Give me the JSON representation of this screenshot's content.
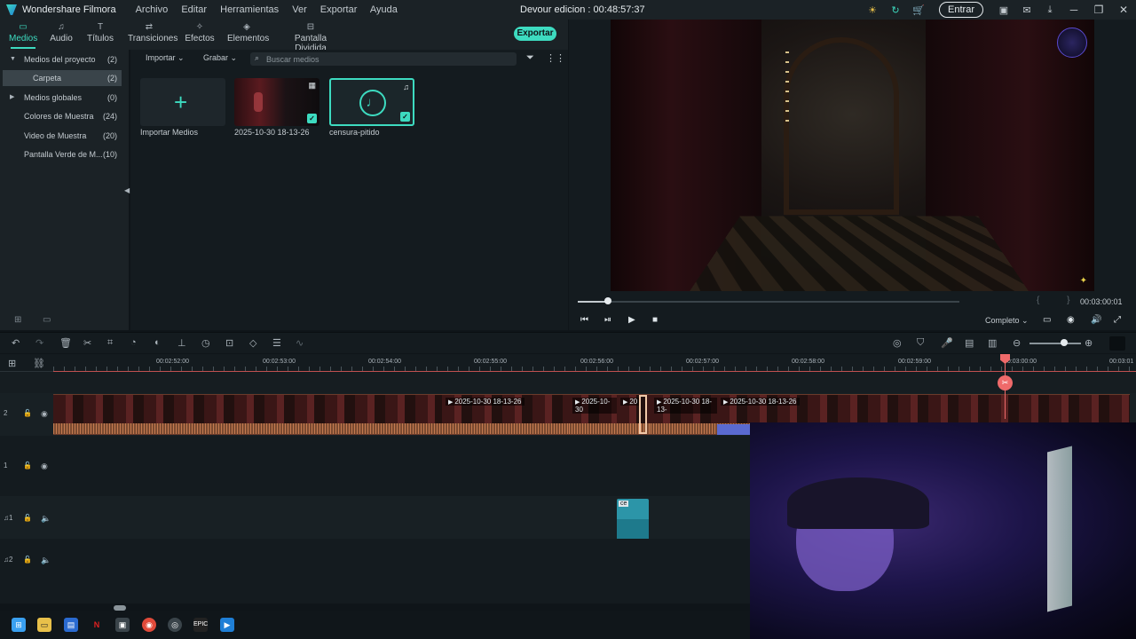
{
  "app": {
    "name": "Wondershare Filmora",
    "project_title": "Devour edicion : 00:48:57:37",
    "menu": [
      "Archivo",
      "Editar",
      "Herramientas",
      "Ver",
      "Exportar",
      "Ayuda"
    ],
    "login_label": "Entrar"
  },
  "tabs": [
    {
      "label": "Medios",
      "icon": "folder-icon",
      "active": true
    },
    {
      "label": "Audio",
      "icon": "music-icon"
    },
    {
      "label": "Títulos",
      "icon": "text-icon"
    },
    {
      "label": "Transiciones",
      "icon": "transition-icon"
    },
    {
      "label": "Efectos",
      "icon": "effects-icon"
    },
    {
      "label": "Elementos",
      "icon": "elements-icon"
    },
    {
      "label": "Pantalla Dividida",
      "icon": "split-screen-icon"
    }
  ],
  "export_label": "Exportar",
  "sidebar": {
    "items": [
      {
        "label": "Medios del proyecto",
        "count": "(2)"
      },
      {
        "label": "Carpeta",
        "count": "(2)",
        "selected": true
      },
      {
        "label": "Medios globales",
        "count": "(0)"
      },
      {
        "label": "Colores de Muestra",
        "count": "(24)"
      },
      {
        "label": "Video de Muestra",
        "count": "(20)"
      },
      {
        "label": "Pantalla Verde de M...",
        "count": "(10)"
      }
    ]
  },
  "media": {
    "import_label": "Importar",
    "record_label": "Grabar",
    "search_placeholder": "Buscar medios",
    "items": [
      {
        "label": "Importar Medios",
        "kind": "import"
      },
      {
        "label": "2025-10-30 18-13-26",
        "kind": "video"
      },
      {
        "label": "censura-pitido",
        "kind": "audio",
        "selected": true
      }
    ]
  },
  "preview": {
    "timecode": "00:03:00:01",
    "quality": "Completo",
    "progress": 0.08,
    "braces": "{ }"
  },
  "timeline": {
    "ruler": [
      "00:02:52:00",
      "00:02:53:00",
      "00:02:54:00",
      "00:02:55:00",
      "00:02:56:00",
      "00:02:57:00",
      "00:02:58:00",
      "00:02:59:00",
      "00:03:00:00",
      "00:03:01"
    ],
    "tracks": [
      {
        "label": "2"
      },
      {
        "label": "1"
      },
      {
        "label": "♫1"
      },
      {
        "label": "♫2"
      }
    ],
    "clips": [
      {
        "name": ""
      },
      {
        "name": "2025-10-30 18-13-26"
      },
      {
        "name": "2025-10-30"
      },
      {
        "name": "20"
      },
      {
        "name": "2025-10-30 18-13-"
      },
      {
        "name": "2025-10-30 18-13-26"
      }
    ],
    "audio_clip": "ce"
  },
  "colors": {
    "accent": "#3ddbc0",
    "playhead": "#ef6a6a",
    "background": "#0f1519"
  }
}
